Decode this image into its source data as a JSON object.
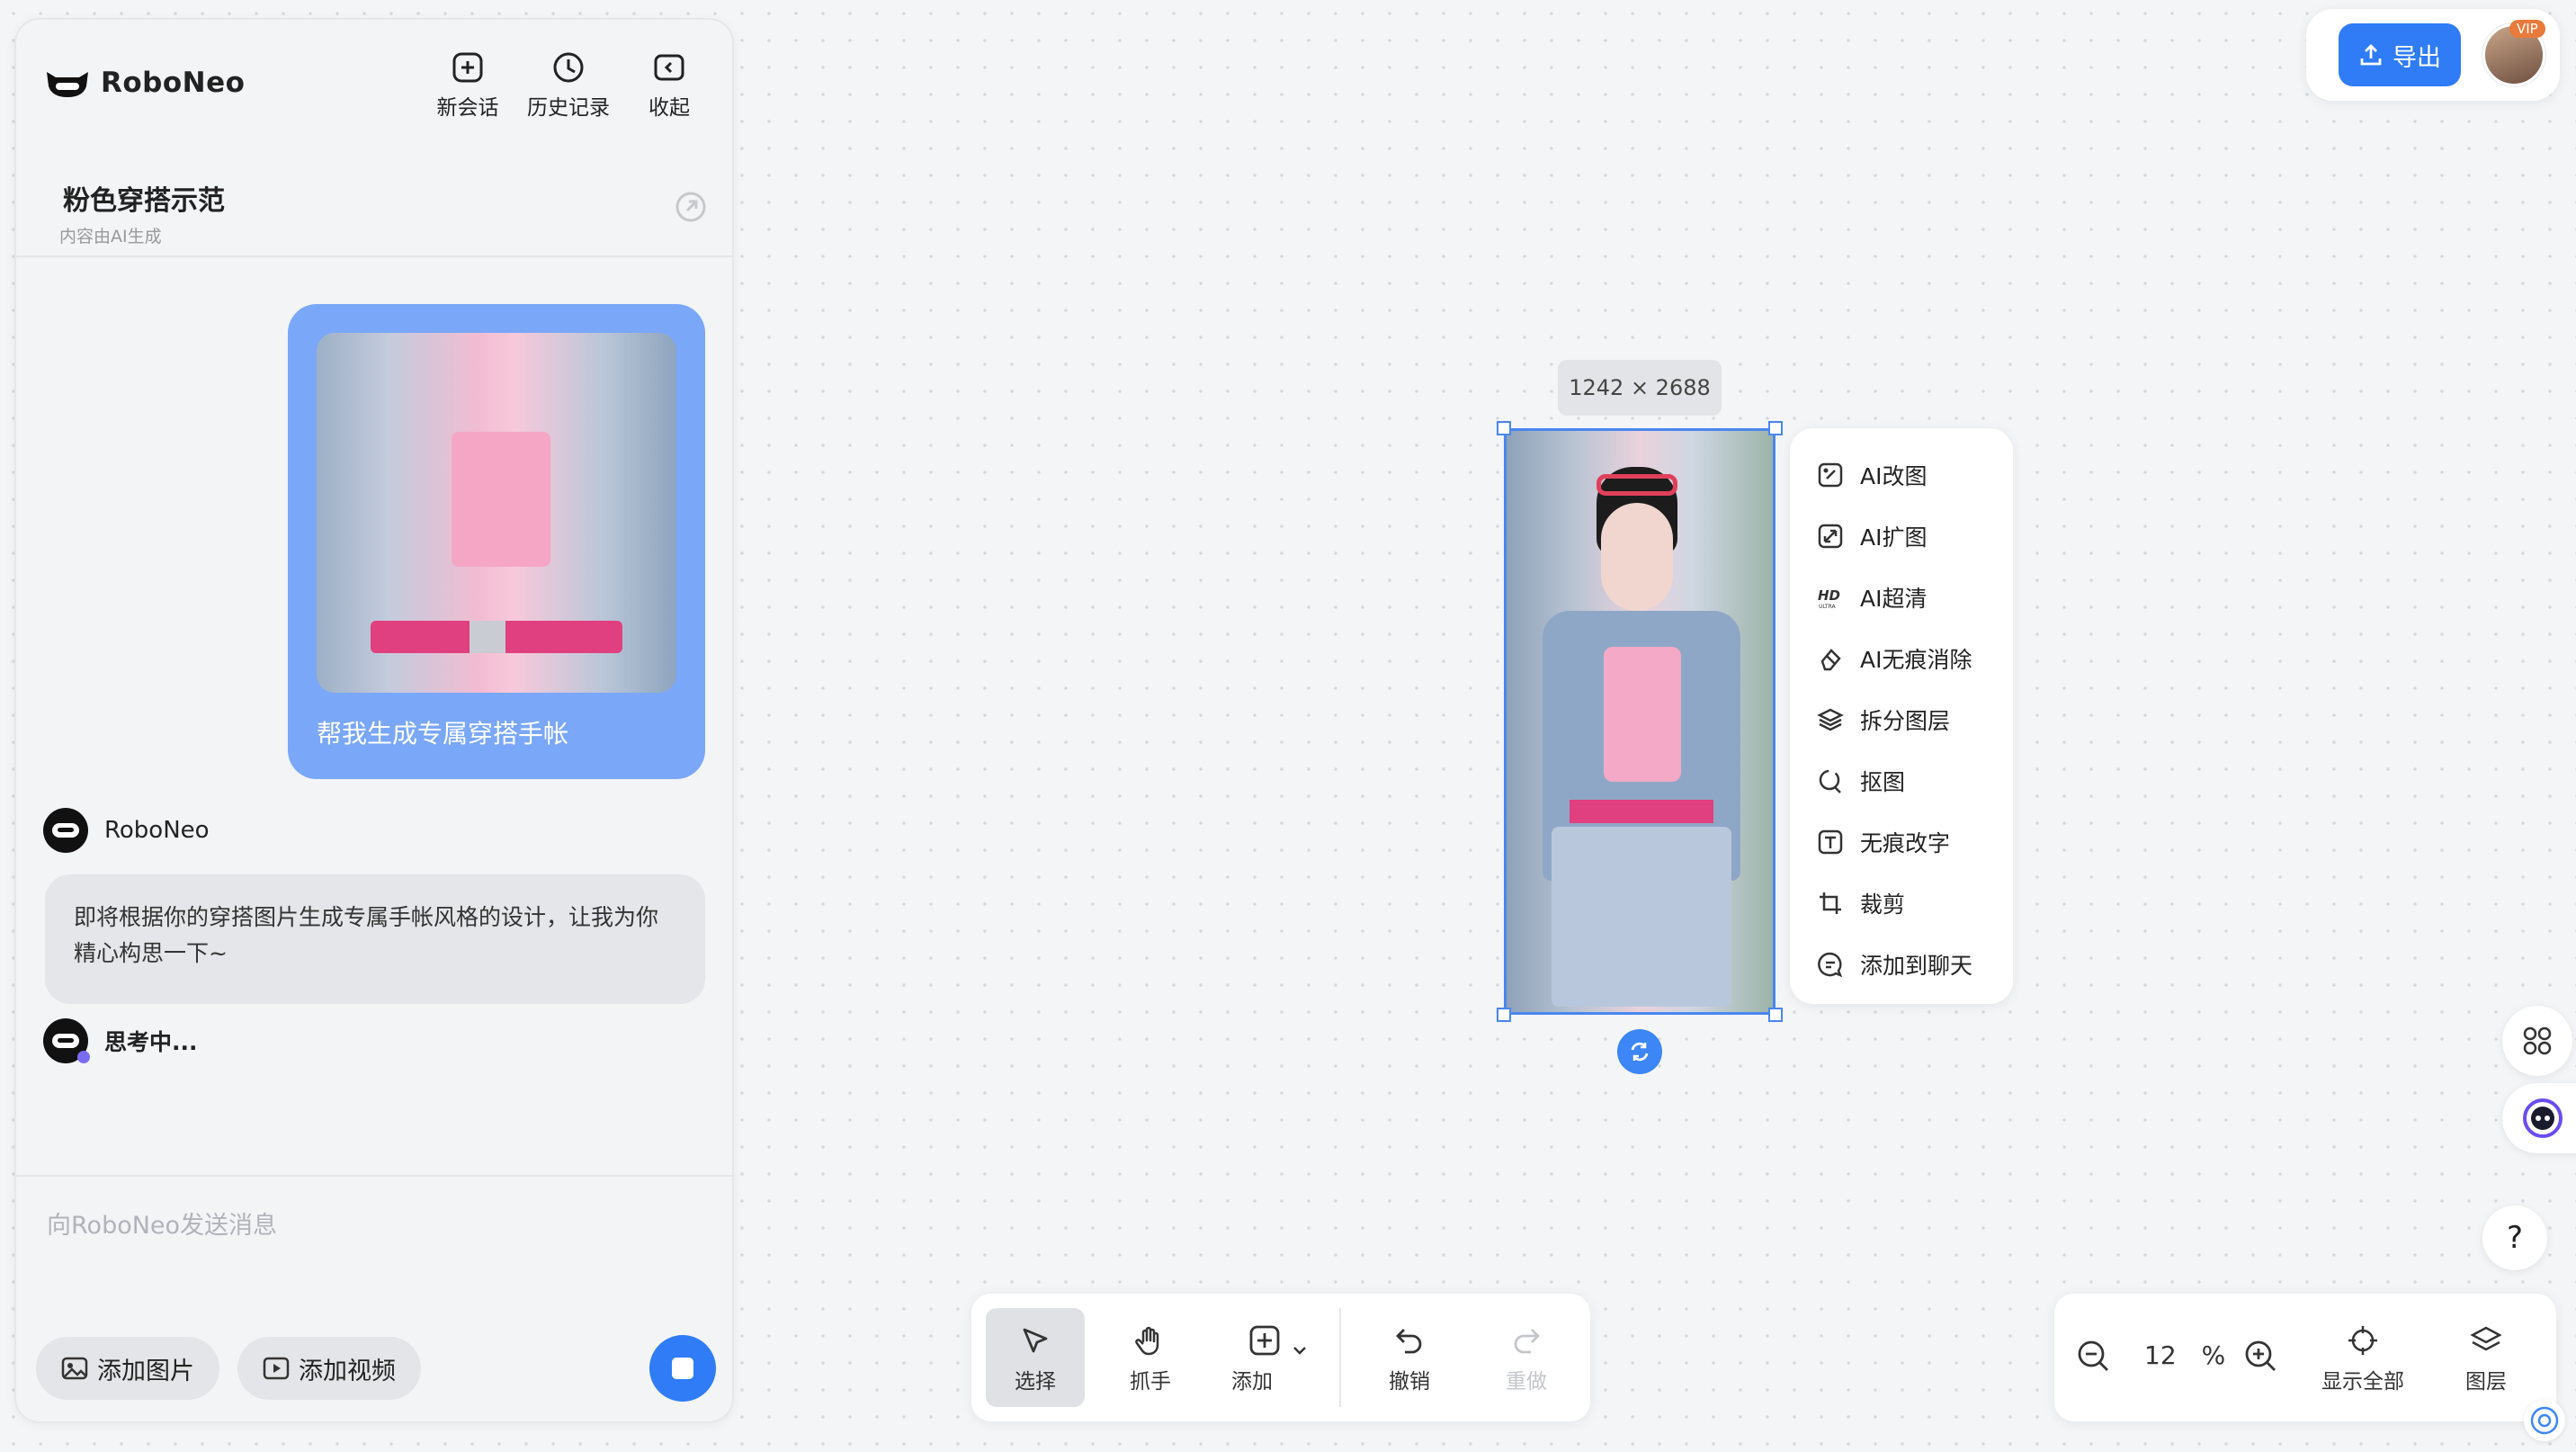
{
  "app": {
    "name": "RoboNeo"
  },
  "header": {
    "new_chat": "新会话",
    "history": "历史记录",
    "collapse": "收起"
  },
  "conversation": {
    "title": "粉色穿搭示范",
    "subtitle": "内容由AI生成"
  },
  "messages": {
    "user_text": "帮我生成专属穿搭手帐",
    "bot_name": "RoboNeo",
    "bot_text": "即将根据你的穿搭图片生成专属手帐风格的设计，让我为你精心构思一下~",
    "thinking": "思考中..."
  },
  "composer": {
    "placeholder": "向RoboNeo发送消息",
    "add_image": "添加图片",
    "add_video": "添加视频"
  },
  "topbar": {
    "export": "导出",
    "vip": "VIP"
  },
  "canvas": {
    "size_label": "1242 × 2688"
  },
  "context_menu": {
    "items": [
      {
        "label": "AI改图",
        "icon": "ai-edit-icon"
      },
      {
        "label": "AI扩图",
        "icon": "ai-expand-icon"
      },
      {
        "label": "AI超清",
        "icon": "hd-icon"
      },
      {
        "label": "AI无痕消除",
        "icon": "eraser-icon"
      },
      {
        "label": "拆分图层",
        "icon": "layers-icon"
      },
      {
        "label": "抠图",
        "icon": "cutout-icon"
      },
      {
        "label": "无痕改字",
        "icon": "text-edit-icon"
      },
      {
        "label": "裁剪",
        "icon": "crop-icon"
      },
      {
        "label": "添加到聊天",
        "icon": "chat-add-icon"
      }
    ]
  },
  "toolbar": {
    "select": "选择",
    "hand": "抓手",
    "add": "添加",
    "undo": "撤销",
    "redo": "重做"
  },
  "zoom": {
    "value": "12",
    "unit": "%",
    "fit_all": "显示全部",
    "layers": "图层"
  },
  "help": "?"
}
